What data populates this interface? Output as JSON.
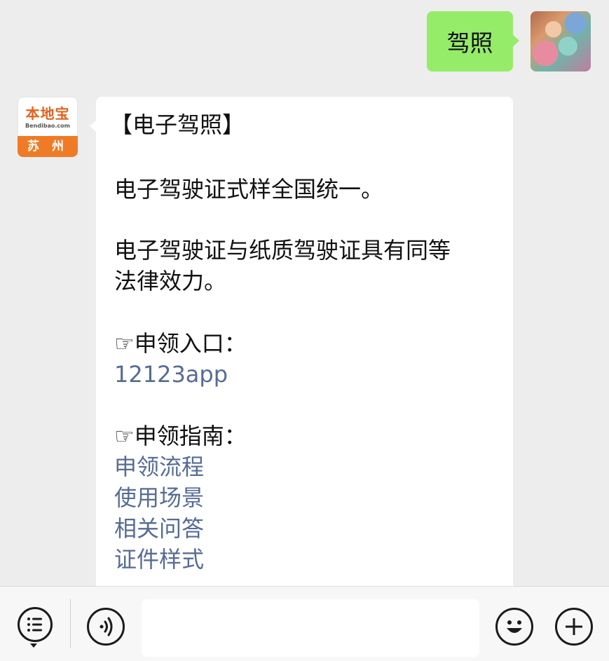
{
  "chat": {
    "outgoing": {
      "text": "驾照"
    },
    "incoming": {
      "bot_avatar": {
        "logo_text": "本地宝",
        "logo_domain": "Bendibao.com",
        "city": "苏 州",
        "brand_color": "#ef7b26"
      },
      "title": "【电子驾照】",
      "paragraph1": "电子驾驶证式样全国统一。",
      "paragraph2_line1": "电子驾驶证与纸质驾驶证具有同等",
      "paragraph2_line2": "法律效力。",
      "apply_entry_label": "☞申领入口：",
      "apply_entry_link": "12123app",
      "guide_label": "☞申领指南：",
      "guide_links": [
        "申领流程",
        "使用场景",
        "相关问答",
        "证件样式"
      ]
    }
  },
  "colors": {
    "outgoing_bubble": "#95ec69",
    "link": "#576b95",
    "background": "#ededed"
  },
  "input_bar": {
    "icons": [
      "menu-icon",
      "voice-icon",
      "emoji-icon",
      "add-icon"
    ]
  }
}
